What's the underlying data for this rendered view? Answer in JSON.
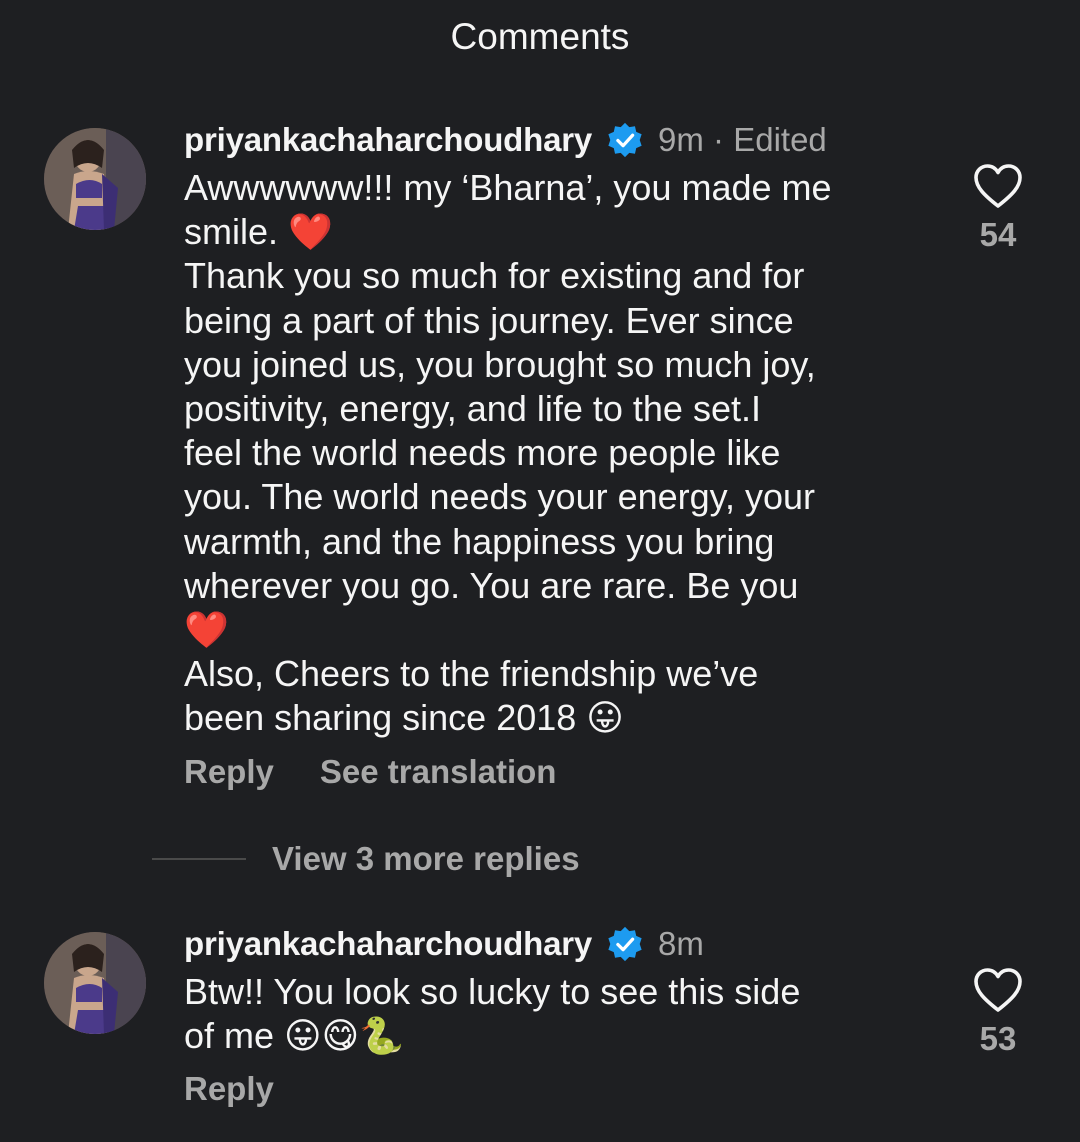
{
  "header": {
    "title": "Comments"
  },
  "comments": [
    {
      "username": "priyankachaharchoudhary",
      "time": "9m",
      "edited": "Edited",
      "text": "Awwwwww!!! my ‘Bharna’, you made me\nsmile. ❤️\nThank you so much for existing and for\nbeing a part of this journey. Ever since\nyou joined us, you brought so much joy,\npositivity, energy, and life to the set.I\nfeel the world needs more people like\nyou. The world needs your energy, your\nwarmth, and the happiness you bring\nwherever you go. You are rare. Be you\n❤️\nAlso, Cheers to the friendship we’ve\nbeen sharing since 2018 😛",
      "reply_label": "Reply",
      "translate_label": "See translation",
      "likes": "54"
    },
    {
      "username": "priyankachaharchoudhary",
      "time": "8m",
      "text": "Btw!! You look so lucky to see this side\nof me 😛😋🐍",
      "reply_label": "Reply",
      "likes": "53"
    }
  ],
  "view_more": "View 3 more replies",
  "icons": {
    "verified": "verified-badge-icon",
    "like": "heart-outline-icon"
  },
  "colors": {
    "background": "#1e1f22",
    "verified": "#1d9bf0",
    "muted": "#a8a8a8"
  }
}
